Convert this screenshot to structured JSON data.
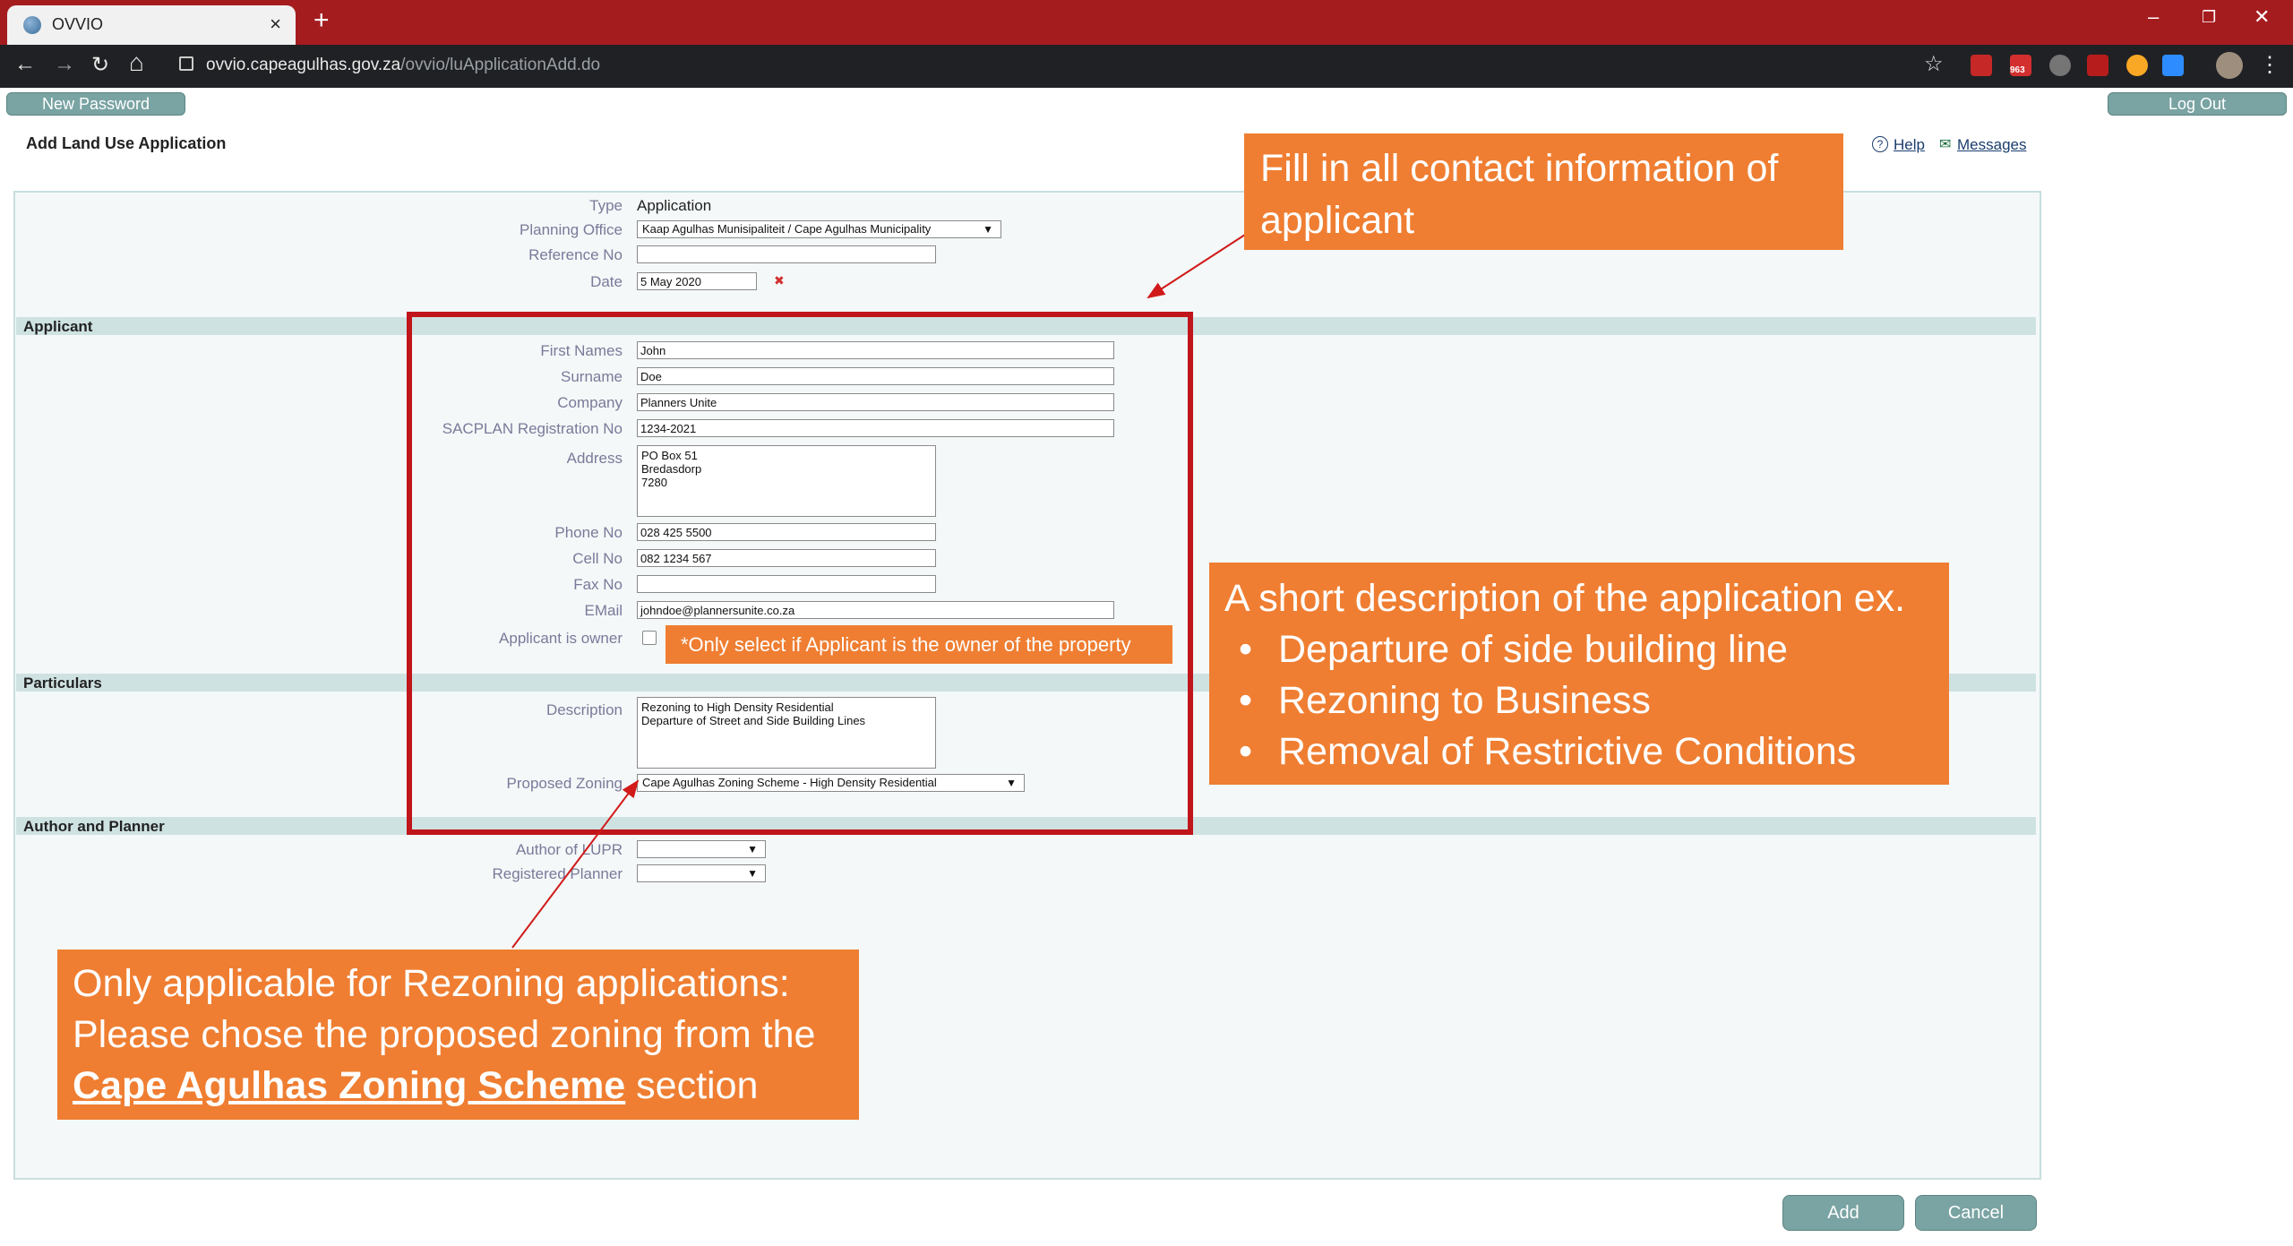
{
  "browser": {
    "tab_title": "OVVIO",
    "tab_close": "×",
    "new_tab": "+",
    "url_host": "ovvio.capeagulhas.gov.za",
    "url_path": "/ovvio/luApplicationAdd.do",
    "window_min": "–",
    "window_restore": "❐",
    "window_close": "✕",
    "back": "←",
    "forward": "→",
    "reload": "↻",
    "home": "⌂",
    "star": "☆",
    "menu": "⋮",
    "ext_badge": "963"
  },
  "header": {
    "new_password": "New Password",
    "log_out": "Log Out",
    "page_title": "Add Land Use Application",
    "help": "Help",
    "messages": "Messages",
    "help_icon": "?",
    "messages_icon": "✉"
  },
  "form": {
    "type_label": "Type",
    "type_value": "Application",
    "planning_office_label": "Planning Office",
    "planning_office_value": "Kaap Agulhas Munisipaliteit / Cape Agulhas Municipality",
    "reference_label": "Reference No",
    "reference_value": "",
    "date_label": "Date",
    "date_value": "5 May 2020",
    "date_clear": "✖",
    "applicant_section": "Applicant",
    "first_names_label": "First Names",
    "first_names_value": "John",
    "surname_label": "Surname",
    "surname_value": "Doe",
    "company_label": "Company",
    "company_value": "Planners Unite",
    "sacplan_label": "SACPLAN Registration No",
    "sacplan_value": "1234-2021",
    "address_label": "Address",
    "address_value": "PO Box 51\nBredasdorp\n7280",
    "phone_label": "Phone No",
    "phone_value": "028 425 5500",
    "cell_label": "Cell No",
    "cell_value": "082 1234 567",
    "fax_label": "Fax No",
    "fax_value": "",
    "email_label": "EMail",
    "email_value": "johndoe@plannersunite.co.za",
    "owner_label": "Applicant is owner",
    "particulars_section": "Particulars",
    "description_label": "Description",
    "description_value": "Rezoning to High Density Residential\nDeparture of Street and Side Building Lines",
    "zoning_label": "Proposed Zoning",
    "zoning_value": "Cape Agulhas Zoning Scheme - High Density Residential",
    "author_section": "Author and Planner",
    "author_label": "Author of LUPR",
    "planner_label": "Registered Planner",
    "select_arrow": "▼",
    "add": "Add",
    "cancel": "Cancel"
  },
  "annotations": {
    "contact_note": "Fill in all contact information of applicant",
    "owner_note": "*Only select if Applicant is the owner of the property",
    "description_heading": "A short description of the application ex.",
    "description_bullets": [
      "Departure of side building line",
      "Rezoning to Business",
      "Removal of Restrictive Conditions"
    ],
    "bullet_char": "•",
    "zoning_line1": "Only applicable for Rezoning applications:",
    "zoning_line2": "Please chose the proposed zoning from the",
    "zoning_link": "Cape Agulhas Zoning Scheme",
    "zoning_suffix": " section"
  },
  "colors": {
    "browser_frame": "#a51c1f",
    "callout": "#ef7e32",
    "highlight_border": "#c0151b",
    "section_band": "#cfe2e2",
    "button": "#7aa3a3"
  }
}
